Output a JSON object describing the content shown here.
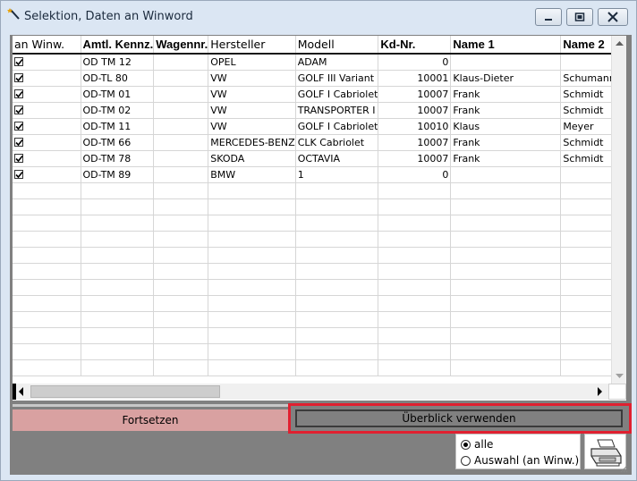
{
  "window": {
    "title": "Selektion, Daten an Winword"
  },
  "grid": {
    "columns": [
      {
        "label": "an Winw.",
        "bold": false,
        "width": 76
      },
      {
        "label": "Amtl. Kennz.",
        "bold": true,
        "width": 76
      },
      {
        "label": "Wagennr.",
        "bold": true,
        "width": 61
      },
      {
        "label": "Hersteller",
        "bold": false,
        "width": 91
      },
      {
        "label": "Modell",
        "bold": false,
        "width": 91
      },
      {
        "label": "Kd-Nr.",
        "bold": true,
        "width": 81
      },
      {
        "label": "Name 1",
        "bold": true,
        "width": 123
      },
      {
        "label": "Name 2",
        "bold": true,
        "width": 70
      }
    ],
    "rows": [
      {
        "checked": true,
        "kennz": "OD TM 12",
        "wagennr": "",
        "hersteller": "OPEL",
        "modell": "ADAM",
        "kdnr": "0",
        "name1": "",
        "name2": ""
      },
      {
        "checked": true,
        "kennz": "OD-TL 80",
        "wagennr": "",
        "hersteller": "VW",
        "modell": "GOLF III Variant",
        "kdnr": "10001",
        "name1": "Klaus-Dieter",
        "name2": "Schumann"
      },
      {
        "checked": true,
        "kennz": "OD-TM 01",
        "wagennr": "",
        "hersteller": "VW",
        "modell": "GOLF I Cabriolet",
        "kdnr": "10007",
        "name1": "Frank",
        "name2": "Schmidt"
      },
      {
        "checked": true,
        "kennz": "OD-TM 02",
        "wagennr": "",
        "hersteller": "VW",
        "modell": "TRANSPORTER I",
        "kdnr": "10007",
        "name1": "Frank",
        "name2": "Schmidt"
      },
      {
        "checked": true,
        "kennz": "OD-TM 11",
        "wagennr": "",
        "hersteller": "VW",
        "modell": "GOLF I Cabriolet",
        "kdnr": "10010",
        "name1": "Klaus",
        "name2": "Meyer"
      },
      {
        "checked": true,
        "kennz": "OD-TM 66",
        "wagennr": "",
        "hersteller": "MERCEDES-BENZ",
        "modell": "CLK Cabriolet",
        "kdnr": "10007",
        "name1": "Frank",
        "name2": "Schmidt"
      },
      {
        "checked": true,
        "kennz": "OD-TM 78",
        "wagennr": "",
        "hersteller": "SKODA",
        "modell": "OCTAVIA",
        "kdnr": "10007",
        "name1": "Frank",
        "name2": "Schmidt"
      },
      {
        "checked": true,
        "kennz": "OD-TM 89",
        "wagennr": "",
        "hersteller": "BMW",
        "modell": "1",
        "kdnr": "0",
        "name1": "",
        "name2": ""
      }
    ],
    "empty_rows": 12
  },
  "buttons": {
    "fortsetzen": "Fortsetzen",
    "ueberblick": "Überblick verwenden"
  },
  "filter": {
    "options": [
      {
        "label": "alle",
        "selected": true
      },
      {
        "label": "Auswahl (an Winw.)",
        "selected": false
      }
    ]
  },
  "icons": {
    "title": "wand-icon",
    "print": "printer-icon"
  },
  "colors": {
    "fortsetzen_bg": "#d9a1a1",
    "highlight_border": "#e02030",
    "panel_gray": "#808080"
  }
}
